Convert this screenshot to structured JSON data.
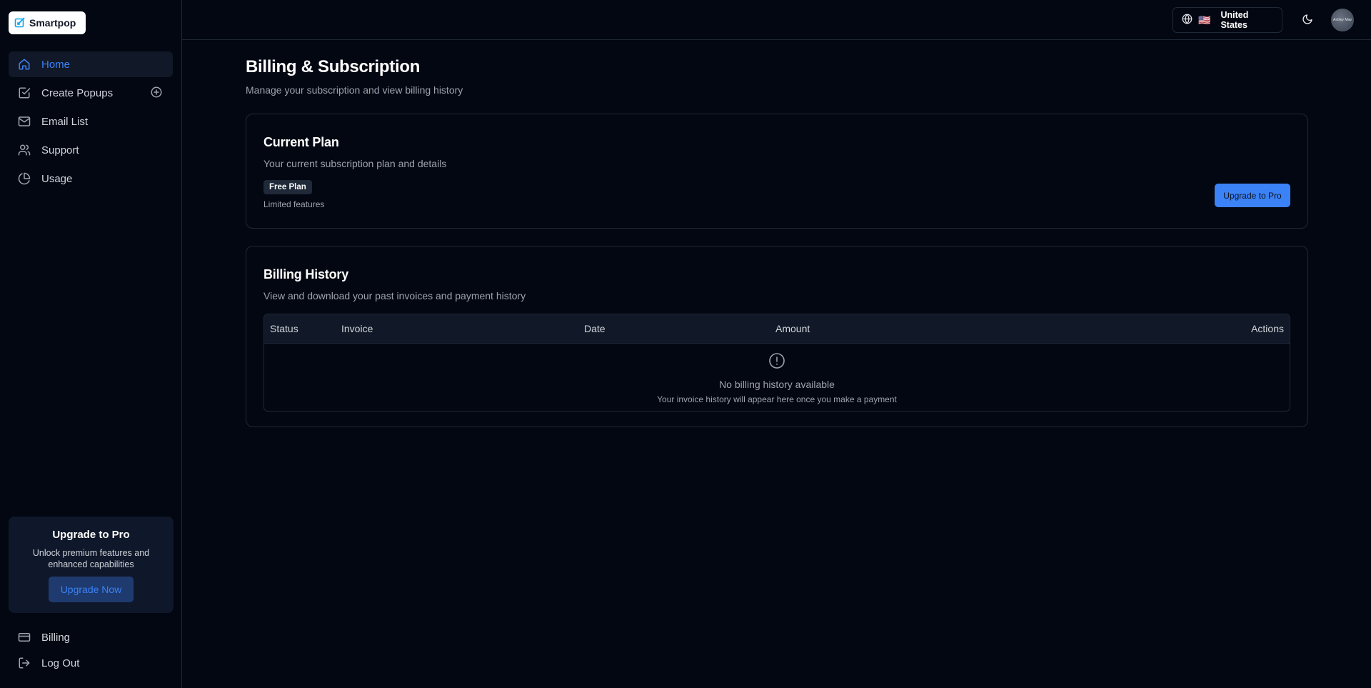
{
  "brand": {
    "name": "Smartpop"
  },
  "sidebar": {
    "items": [
      {
        "label": "Home",
        "icon": "home-icon",
        "active": true
      },
      {
        "label": "Create Popups",
        "icon": "checkbox-edit-icon"
      },
      {
        "label": "Email List",
        "icon": "mail-icon"
      },
      {
        "label": "Support",
        "icon": "users-icon"
      },
      {
        "label": "Usage",
        "icon": "pie-chart-icon"
      }
    ],
    "promo": {
      "title": "Upgrade to Pro",
      "text": "Unlock premium features and enhanced capabilities",
      "button": "Upgrade Now"
    },
    "bottom": [
      {
        "label": "Billing",
        "icon": "credit-card-icon"
      },
      {
        "label": "Log Out",
        "icon": "logout-icon"
      }
    ]
  },
  "topbar": {
    "country_flag": "🇺🇸",
    "country_label": "United States",
    "avatar_text": "Ashley Mae"
  },
  "page": {
    "title": "Billing & Subscription",
    "subtitle": "Manage your subscription and view billing history"
  },
  "plan_card": {
    "title": "Current Plan",
    "subtitle": "Your current subscription plan and details",
    "badge": "Free Plan",
    "note": "Limited features",
    "button": "Upgrade to Pro"
  },
  "history_card": {
    "title": "Billing History",
    "subtitle": "View and download your past invoices and payment history",
    "columns": [
      "Status",
      "Invoice",
      "Date",
      "Amount",
      "Actions"
    ],
    "empty_title": "No billing history available",
    "empty_sub": "Your invoice history will appear here once you make a payment"
  },
  "colors": {
    "background": "#030712",
    "accent": "#3b82f6",
    "border": "#1f2937"
  }
}
